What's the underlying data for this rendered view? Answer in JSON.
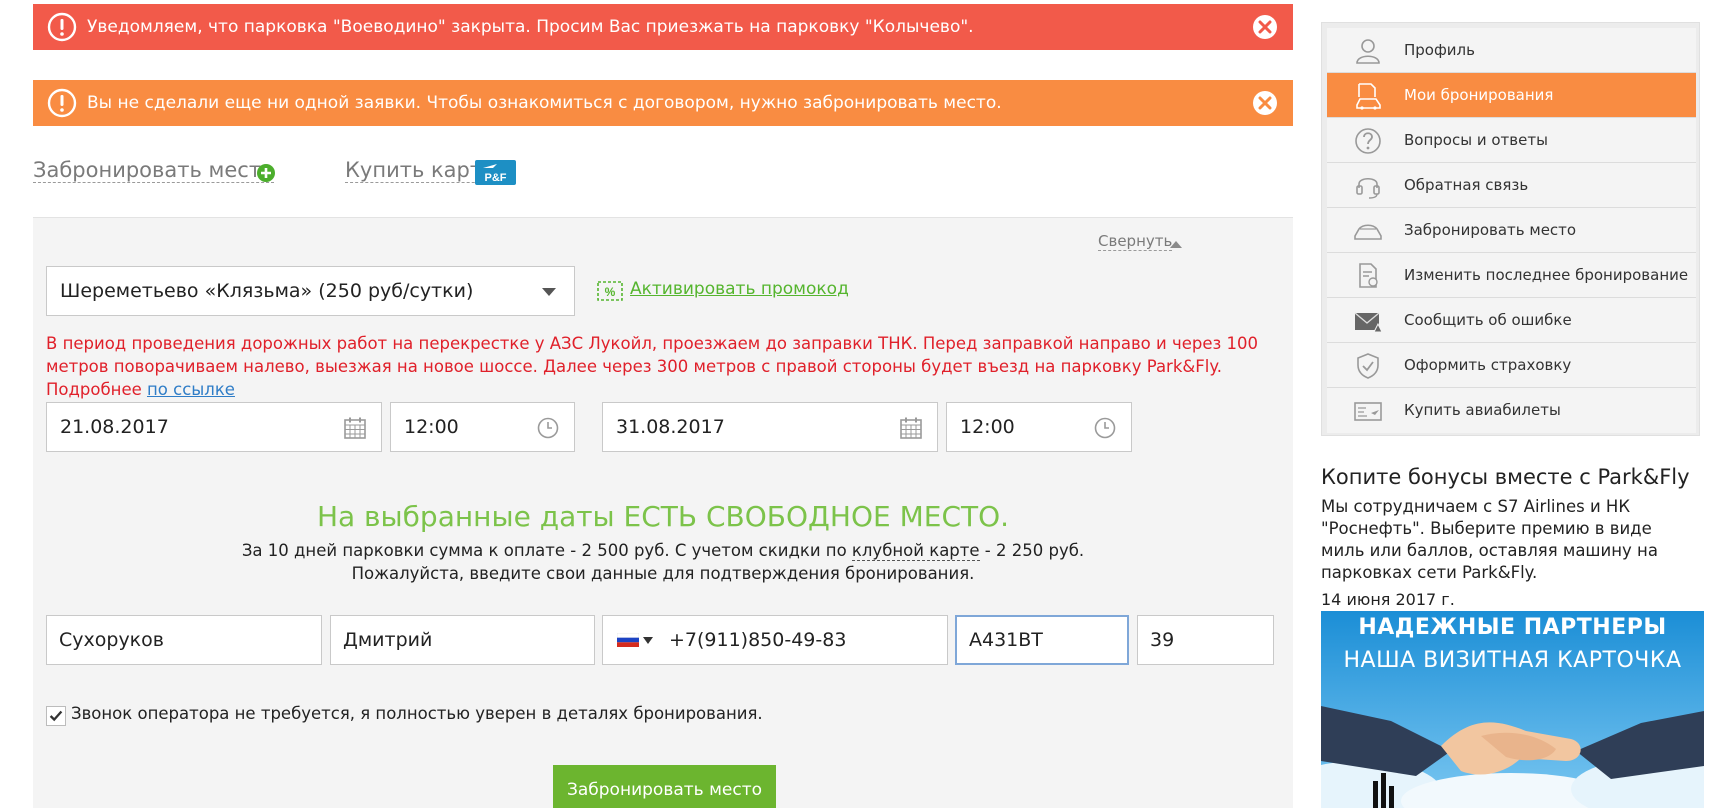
{
  "alerts": {
    "closed_parking": "Уведомляем, что парковка \"Воеводино\" закрыта. Просим Вас приезжать на парковку \"Колычево\".",
    "no_orders": "Вы не сделали еще ни одной заявки. Чтобы ознакомиться с договором, нужно забронировать место."
  },
  "actions": {
    "book_place": "Забронировать место",
    "buy_card": "Купить карту",
    "card_badge": "P&F"
  },
  "form": {
    "collapse": "Свернуть",
    "parking_selected": "Шереметьево «Клязьма» (250 руб/сутки)",
    "promo_link": "Активировать промокод",
    "road_note": "В период проведения дорожных работ на перекрестке у АЗС Лукойл, проезжаем до заправки ТНК. Перед заправкой направо и через 100 метров поворачиваем налево, выезжая на новое шоссе. Далее через 300 метров с правой стороны будет въезд на парковку Park&Fly. Подробнее",
    "road_note_link": "по ссылке",
    "date_from": "21.08.2017",
    "time_from": "12:00",
    "date_to": "31.08.2017",
    "time_to": "12:00",
    "availability": "На выбранные даты ЕСТЬ СВОБОДНОЕ МЕСТО.",
    "price_prefix": "За 10 дней парковки сумма к оплате - 2 500 руб. С учетом скидки по",
    "price_club": "клубной карте",
    "price_suffix": "- 2 250 руб.",
    "confirm_text": "Пожалуйста, введите свои данные для подтверждения бронирования.",
    "last_name": "Сухоруков",
    "first_name": "Дмитрий",
    "phone": "+7(911)850-49-83",
    "car_plate": "А431ВТ",
    "region": "39",
    "no_call_label": "Звонок оператора не требуется, я полностью уверен в деталях бронирования.",
    "no_call_checked": true,
    "submit": "Забронировать место"
  },
  "sidebar": {
    "items": [
      {
        "label": "Профиль",
        "icon": "user-icon",
        "active": false
      },
      {
        "label": "Мои бронирования",
        "icon": "booking-car-icon",
        "active": true
      },
      {
        "label": "Вопросы и ответы",
        "icon": "question-icon",
        "active": false
      },
      {
        "label": "Обратная связь",
        "icon": "headset-icon",
        "active": false
      },
      {
        "label": "Забронировать место",
        "icon": "car-icon",
        "active": false
      },
      {
        "label": "Изменить последнее бронирование",
        "icon": "edit-document-icon",
        "active": false
      },
      {
        "label": "Сообщить об ошибке",
        "icon": "mail-warning-icon",
        "active": false
      },
      {
        "label": "Оформить страховку",
        "icon": "shield-icon",
        "active": false
      },
      {
        "label": "Купить авиабилеты",
        "icon": "ticket-icon",
        "active": false
      }
    ]
  },
  "promo": {
    "title": "Копите бонусы вместе с Park&Fly",
    "text": "Мы сотрудничаем с S7 Airlines и НК \"Роснефть\". Выберите премию в виде миль или баллов, оставляя машину на парковках сети Park&Fly.",
    "date": "14 июня 2017 г.",
    "banner_line1": "НАДЕЖНЫЕ ПАРТНЕРЫ",
    "banner_line2": "НАША ВИЗИТНАЯ КАРТОЧКА"
  },
  "colors": {
    "alert_red": "#f25a4a",
    "alert_orange": "#f98c42",
    "accent_green": "#6cb52f",
    "availability_green": "#7cc34a",
    "note_red": "#e0202a",
    "sidebar_active": "#f98c42"
  }
}
